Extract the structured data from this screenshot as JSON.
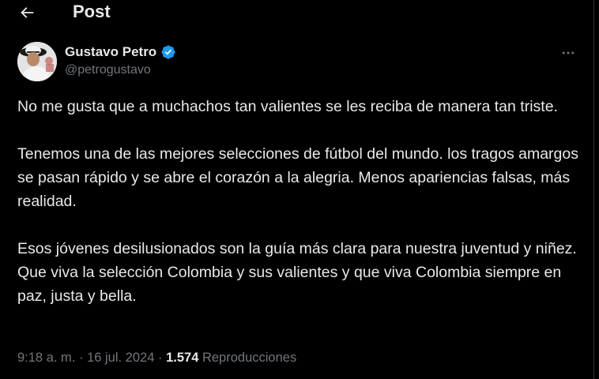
{
  "header": {
    "back_icon": "arrow-left-icon",
    "title": "Post"
  },
  "author": {
    "avatar_icon": "avatar",
    "display_name": "Gustavo Petro",
    "verified_icon": "verified-badge-icon",
    "handle": "@petrogustavo",
    "more_icon": "more-horizontal-icon"
  },
  "tweet": {
    "paragraphs": [
      "No me gusta que a muchachos tan valientes se les reciba de manera tan triste.",
      "Tenemos una de las mejores selecciones de fútbol del mundo. los tragos amargos se pasan rápido y se abre el corazón a la alegria. Menos apariencias falsas, más realidad.",
      "Esos jóvenes desilusionados son la guía más clara para nuestra juventud y niñez. Que viva la selección Colombia y sus valientes y que viva Colombia siempre en paz, justa y bella."
    ]
  },
  "meta": {
    "time": "9:18 a. m.",
    "separator": "·",
    "date": "16 jul. 2024",
    "views_count": "1.574",
    "views_label": "Reproducciones"
  },
  "colors": {
    "background": "#000000",
    "text_primary": "#e7e9ea",
    "text_secondary": "#71767b",
    "verified_blue": "#1d9bf0"
  }
}
